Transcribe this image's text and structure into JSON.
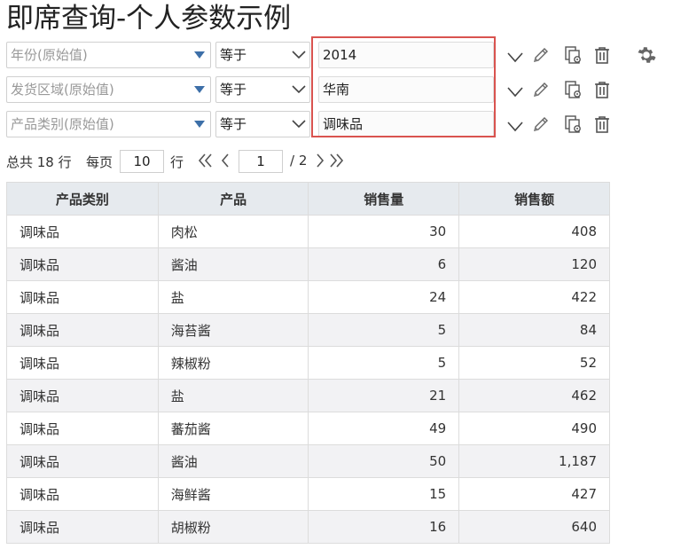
{
  "page": {
    "title": "即席查询-个人参数示例"
  },
  "filters": [
    {
      "field_placeholder": "年份(原始值)",
      "operator": "等于",
      "value": "2014"
    },
    {
      "field_placeholder": "发货区域(原始值)",
      "operator": "等于",
      "value": "华南"
    },
    {
      "field_placeholder": "产品类别(原始值)",
      "operator": "等于",
      "value": "调味品"
    }
  ],
  "icons": {
    "edit": "pencil-icon",
    "copy": "copy-settings-icon",
    "delete": "trash-icon",
    "settings": "gear-icon"
  },
  "highlight_color": "#d9534f",
  "pager": {
    "total_label": "总共 18 行",
    "per_page_label": "每页",
    "per_page": "10",
    "row_unit": "行",
    "current_page": "1",
    "total_pages": "/ 2"
  },
  "table": {
    "headers": [
      "产品类别",
      "产品",
      "销售量",
      "销售额"
    ],
    "rows": [
      [
        "调味品",
        "肉松",
        "30",
        "408"
      ],
      [
        "调味品",
        "酱油",
        "6",
        "120"
      ],
      [
        "调味品",
        "盐",
        "24",
        "422"
      ],
      [
        "调味品",
        "海苔酱",
        "5",
        "84"
      ],
      [
        "调味品",
        "辣椒粉",
        "5",
        "52"
      ],
      [
        "调味品",
        "盐",
        "21",
        "462"
      ],
      [
        "调味品",
        "蕃茄酱",
        "49",
        "490"
      ],
      [
        "调味品",
        "酱油",
        "50",
        "1,187"
      ],
      [
        "调味品",
        "海鲜酱",
        "15",
        "427"
      ],
      [
        "调味品",
        "胡椒粉",
        "16",
        "640"
      ]
    ]
  }
}
